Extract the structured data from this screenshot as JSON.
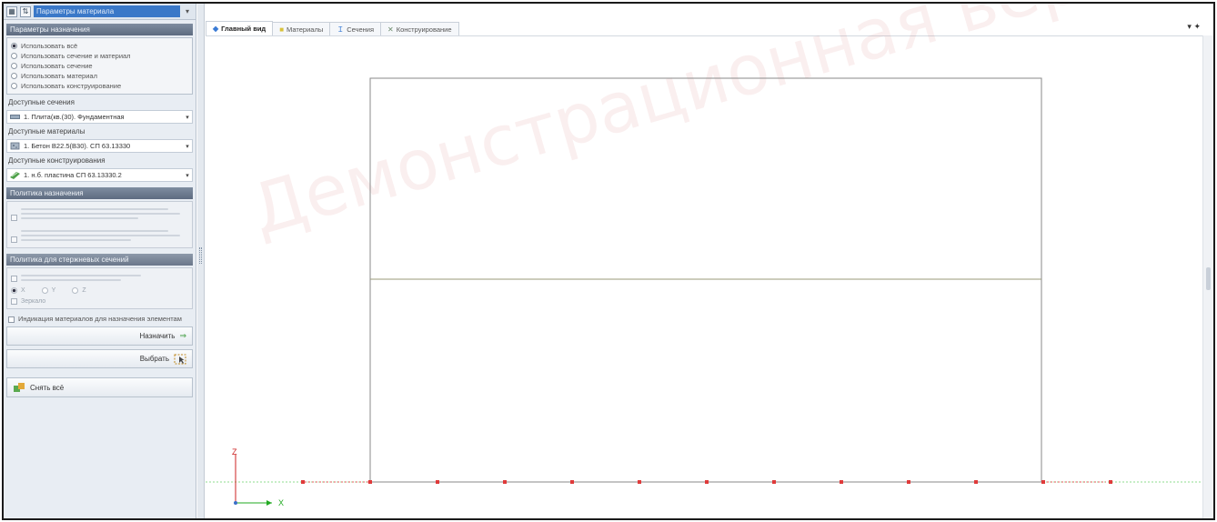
{
  "left_panel": {
    "top_combo": "Параметры материала",
    "params_header": "Параметры назначения",
    "use_options": [
      {
        "label": "Использовать всё",
        "checked": true
      },
      {
        "label": "Использовать сечение и материал",
        "checked": false
      },
      {
        "label": "Использовать сечение",
        "checked": false
      },
      {
        "label": "Использовать материал",
        "checked": false
      },
      {
        "label": "Использовать конструирование",
        "checked": false
      }
    ],
    "sections_label": "Доступные сечения",
    "sections_value": "1. Плита(кв.(30). Фундаментная",
    "materials_label": "Доступные материалы",
    "materials_value": "1. Бетон В22.5(В30). СП 63.13330",
    "design_label": "Доступные конструирования",
    "design_value": "1. н.б. пластина СП 63.13330.2",
    "policy_header": "Политика назначения",
    "policy_option_1": "При несоответствии назначаемого элементу сечения для назначаемого материала оставлять материал",
    "policy_option_2": "При несоответствии назначаемого элементу сечения для назначаемого материала оставлять сечение",
    "rods_header": "Политика для стержневых сечений",
    "rods_option": "При назначении материала сохранять ориентацию",
    "axis_x": "X",
    "axis_y": "Y",
    "axis_z": "Z",
    "mirror_label": "Зеркало",
    "indication_label": "Индикация материалов для назначения элементам",
    "assign_button": "Назначить",
    "select_button": "Выбрать",
    "reset_button": "Снять всё"
  },
  "tabs": [
    {
      "label": "Главный вид",
      "icon": "view-icon",
      "active": true
    },
    {
      "label": "Материалы",
      "icon": "materials-icon",
      "active": false
    },
    {
      "label": "Сечения",
      "icon": "section-icon",
      "active": false
    },
    {
      "label": "Конструирование",
      "icon": "design-icon",
      "active": false
    }
  ],
  "viewport": {
    "watermark": "Демонстрационная версия",
    "axis_z": "Z",
    "axis_x": "X"
  },
  "colors": {
    "node": "#e03a3a",
    "frame_line": "#7a7a7a",
    "ground_line": "#7fd67f",
    "axis_x": "#22aa22",
    "axis_z": "#cc2222"
  }
}
